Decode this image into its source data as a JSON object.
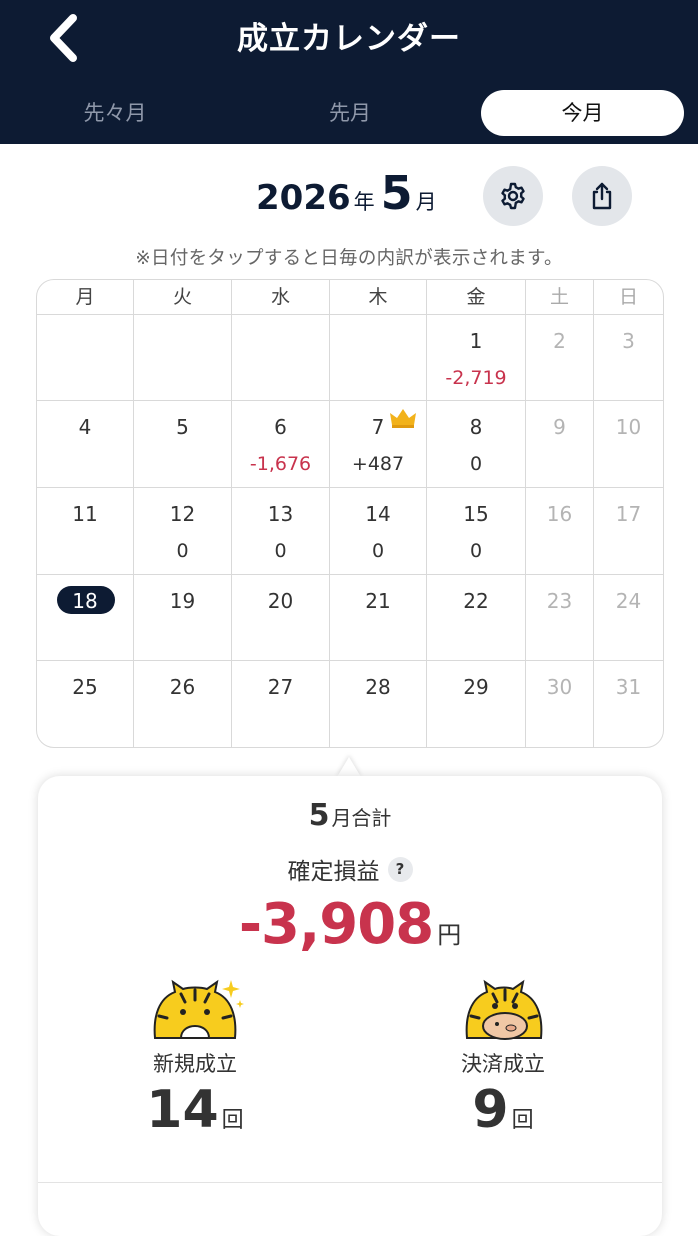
{
  "header": {
    "title": "成立カレンダー",
    "back_icon": "chevron-left-icon",
    "background_color": "#0d1b33"
  },
  "tabs": [
    {
      "label": "先々月",
      "selected": false
    },
    {
      "label": "先月",
      "selected": false
    },
    {
      "label": "今月",
      "selected": true
    }
  ],
  "month_selector": {
    "year": "2026",
    "year_unit": "年",
    "month": "5",
    "month_unit": "月",
    "settings_icon": "gear-icon",
    "share_icon": "share-icon"
  },
  "note": "※日付をタップすると日毎の内訳が表示されます。",
  "calendar": {
    "weekdays": [
      "月",
      "火",
      "水",
      "木",
      "金",
      "土",
      "日"
    ],
    "today": "18",
    "weeks": [
      [
        {
          "day": "",
          "value": ""
        },
        {
          "day": "",
          "value": ""
        },
        {
          "day": "",
          "value": ""
        },
        {
          "day": "",
          "value": ""
        },
        {
          "day": "1",
          "value": "-2,719",
          "negative": true
        },
        {
          "day": "2",
          "value": ""
        },
        {
          "day": "3",
          "value": ""
        }
      ],
      [
        {
          "day": "4",
          "value": ""
        },
        {
          "day": "5",
          "value": ""
        },
        {
          "day": "6",
          "value": "-1,676",
          "negative": true
        },
        {
          "day": "7",
          "value": "+487",
          "crown": true
        },
        {
          "day": "8",
          "value": "0"
        },
        {
          "day": "9",
          "value": ""
        },
        {
          "day": "10",
          "value": ""
        }
      ],
      [
        {
          "day": "11",
          "value": ""
        },
        {
          "day": "12",
          "value": "0"
        },
        {
          "day": "13",
          "value": "0"
        },
        {
          "day": "14",
          "value": "0"
        },
        {
          "day": "15",
          "value": "0"
        },
        {
          "day": "16",
          "value": ""
        },
        {
          "day": "17",
          "value": ""
        }
      ],
      [
        {
          "day": "18",
          "value": "",
          "today": true
        },
        {
          "day": "19",
          "value": ""
        },
        {
          "day": "20",
          "value": ""
        },
        {
          "day": "21",
          "value": ""
        },
        {
          "day": "22",
          "value": ""
        },
        {
          "day": "23",
          "value": ""
        },
        {
          "day": "24",
          "value": ""
        }
      ],
      [
        {
          "day": "25",
          "value": ""
        },
        {
          "day": "26",
          "value": ""
        },
        {
          "day": "27",
          "value": ""
        },
        {
          "day": "28",
          "value": ""
        },
        {
          "day": "29",
          "value": ""
        },
        {
          "day": "30",
          "value": ""
        },
        {
          "day": "31",
          "value": ""
        }
      ]
    ],
    "negative_color": "#c8334d",
    "crown_icon": "crown-icon"
  },
  "summary": {
    "month": "5",
    "title_suffix": "月合計",
    "pl_label": "確定損益",
    "help_icon_label": "?",
    "pl_value": "-3,908",
    "pl_unit": "円",
    "new_trades": {
      "label": "新規成立",
      "count": "14",
      "unit": "回",
      "icon": "tiger-mascot-sparkle-icon"
    },
    "settled_trades": {
      "label": "決済成立",
      "count": "9",
      "unit": "回",
      "icon": "tiger-mascot-piggybank-icon"
    }
  }
}
